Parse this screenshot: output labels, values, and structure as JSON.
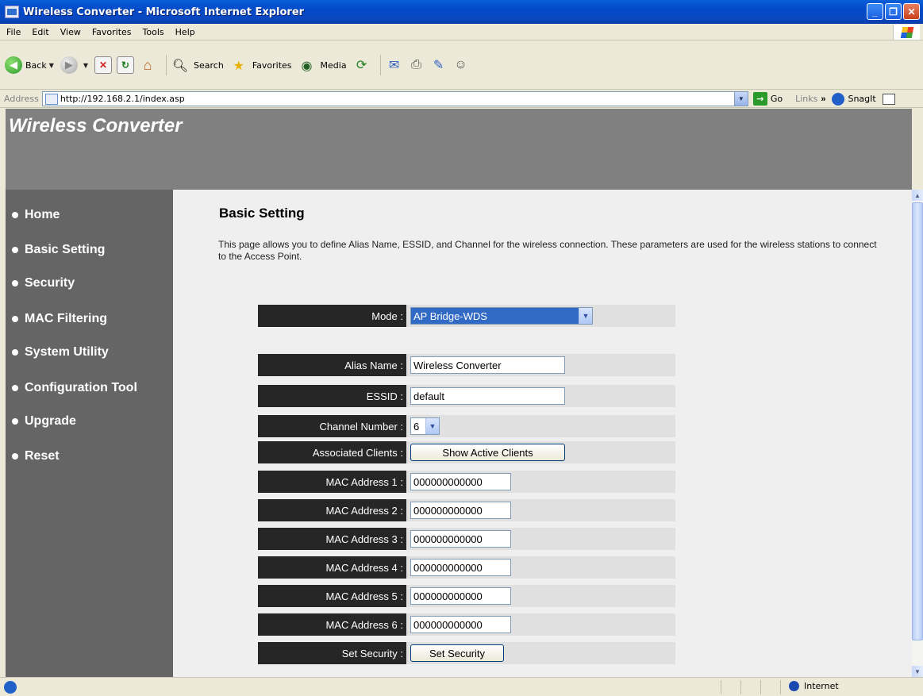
{
  "window": {
    "title": "Wireless Converter - Microsoft Internet Explorer"
  },
  "menubar": {
    "items": [
      "File",
      "Edit",
      "View",
      "Favorites",
      "Tools",
      "Help"
    ]
  },
  "toolbar": {
    "back_label": "Back",
    "search_label": "Search",
    "favorites_label": "Favorites",
    "media_label": "Media"
  },
  "addressbar": {
    "label": "Address",
    "url": "http://192.168.2.1/index.asp",
    "go_label": "Go",
    "links_label": "Links",
    "snagit_label": "SnagIt"
  },
  "page": {
    "brand": "Wireless Converter",
    "nav": [
      "Home",
      "Basic Setting",
      "Security",
      "MAC Filtering",
      "System Utility",
      "Configuration Tool",
      "Upgrade",
      "Reset"
    ],
    "title": "Basic Setting",
    "description": "This page allows you to define Alias Name, ESSID, and Channel for the wireless connection. These parameters are used for the wireless stations to connect to the Access Point.",
    "form": {
      "mode_label": "Mode :",
      "mode_value": "AP Bridge-WDS",
      "alias_label": "Alias Name :",
      "alias_value": "Wireless Converter",
      "essid_label": "ESSID :",
      "essid_value": "default",
      "channel_label": "Channel Number :",
      "channel_value": "6",
      "clients_label": "Associated Clients :",
      "clients_button": "Show Active Clients",
      "mac_rows": [
        {
          "label": "MAC Address 1 :",
          "value": "000000000000"
        },
        {
          "label": "MAC Address 2 :",
          "value": "000000000000"
        },
        {
          "label": "MAC Address 3 :",
          "value": "000000000000"
        },
        {
          "label": "MAC Address 4 :",
          "value": "000000000000"
        },
        {
          "label": "MAC Address 5 :",
          "value": "000000000000"
        },
        {
          "label": "MAC Address 6 :",
          "value": "000000000000"
        }
      ],
      "security_label": "Set Security :",
      "security_button": "Set Security"
    }
  },
  "statusbar": {
    "zone": "Internet"
  },
  "colors": {
    "titlebar": "#0349c8",
    "header_band": "#808080",
    "sidebar": "#656565",
    "label_cell": "#262626",
    "value_cell": "#e0e0e0",
    "main_bg": "#efefef"
  }
}
